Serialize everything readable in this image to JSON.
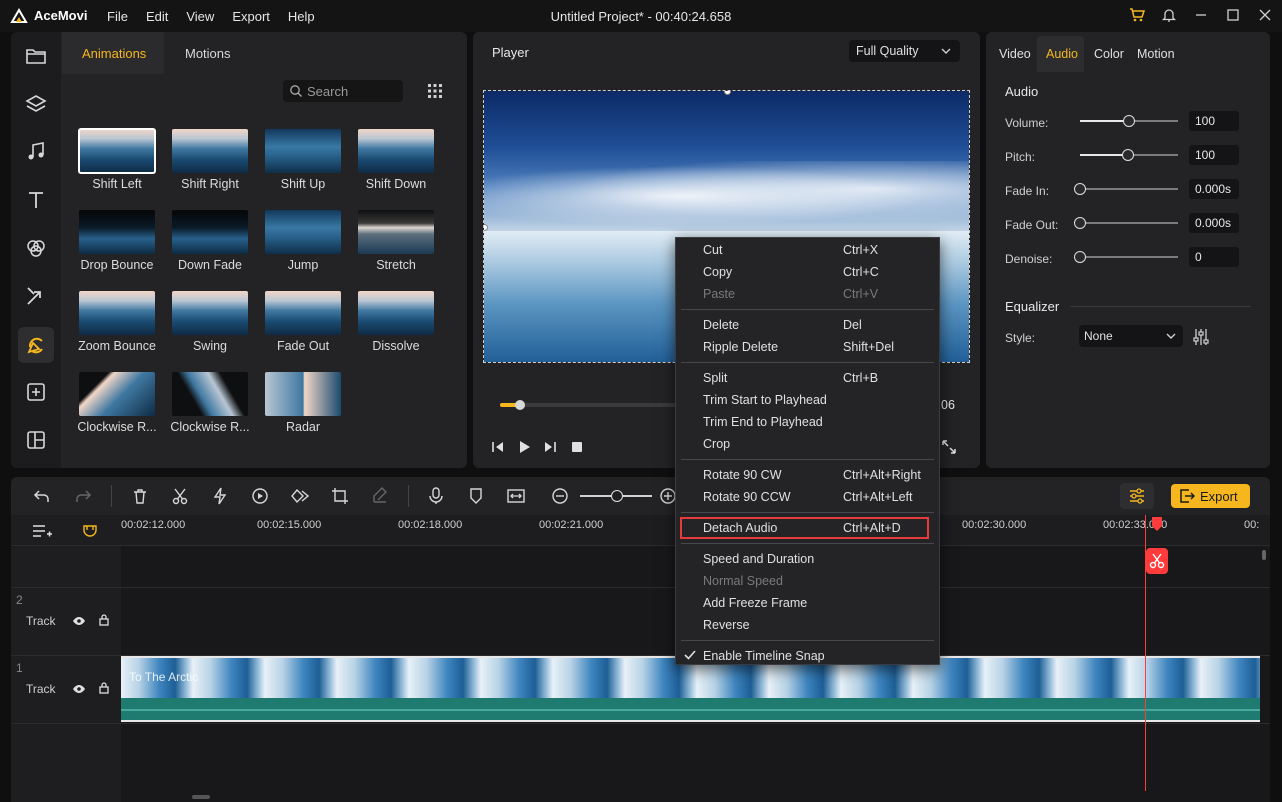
{
  "app": {
    "brand": "AceMovi",
    "window_title": "Untitled Project* - 00:40:24.658",
    "menu": [
      "File",
      "Edit",
      "View",
      "Export",
      "Help"
    ]
  },
  "media_panel": {
    "tabs": [
      "Animations",
      "Motions"
    ],
    "active_tab": "Animations",
    "search_placeholder": "Search",
    "animations": [
      "Shift Left",
      "Shift Right",
      "Shift Up",
      "Shift Down",
      "Drop Bounce",
      "Down Fade",
      "Jump",
      "Stretch",
      "Zoom Bounce",
      "Swing",
      "Fade Out",
      "Dissolve",
      "Clockwise R...",
      "Clockwise R...",
      "Radar"
    ],
    "selected_animation": "Shift Left",
    "sidebar_icons": [
      "folder-icon",
      "layers-icon",
      "music-icon",
      "text-icon",
      "filters-icon",
      "transitions-icon",
      "animation-icon",
      "sticker-icon",
      "split-screen-icon"
    ],
    "active_sidebar_icon": "animation-icon"
  },
  "player": {
    "title": "Player",
    "quality": "Full Quality",
    "timecode_tail": "06",
    "progress_fraction": 0.11
  },
  "properties": {
    "tabs": [
      "Video",
      "Audio",
      "Color",
      "Motion"
    ],
    "active_tab": "Audio",
    "audio_section": "Audio",
    "fields": [
      {
        "label": "Volume:",
        "value": "100",
        "fraction": 0.5
      },
      {
        "label": "Pitch:",
        "value": "100",
        "fraction": 0.49
      },
      {
        "label": "Fade In:",
        "value": "0.000s",
        "fraction": 0.0
      },
      {
        "label": "Fade Out:",
        "value": "0.000s",
        "fraction": 0.0
      },
      {
        "label": "Denoise:",
        "value": "0",
        "fraction": 0.0
      }
    ],
    "equalizer_section": "Equalizer",
    "style_label": "Style:",
    "style_value": "None"
  },
  "toolbar": {
    "export_label": "Export",
    "zoom_fraction": 0.5
  },
  "timeline": {
    "ticks": [
      "00:02:12.000",
      "00:02:15.000",
      "00:02:18.000",
      "00:02:21.000",
      "00:02:30.000",
      "00:02:33.000",
      "00:"
    ],
    "tracks": [
      {
        "number": "2",
        "label": "Track"
      },
      {
        "number": "1",
        "label": "Track"
      }
    ],
    "clip_title": "To The Arctic"
  },
  "context_menu": {
    "groups": [
      [
        {
          "label": "Cut",
          "shortcut": "Ctrl+X",
          "enabled": true
        },
        {
          "label": "Copy",
          "shortcut": "Ctrl+C",
          "enabled": true
        },
        {
          "label": "Paste",
          "shortcut": "Ctrl+V",
          "enabled": false
        }
      ],
      [
        {
          "label": "Delete",
          "shortcut": "Del",
          "enabled": true
        },
        {
          "label": "Ripple Delete",
          "shortcut": "Shift+Del",
          "enabled": true
        }
      ],
      [
        {
          "label": "Split",
          "shortcut": "Ctrl+B",
          "enabled": true
        },
        {
          "label": "Trim Start to Playhead",
          "shortcut": "",
          "enabled": true
        },
        {
          "label": "Trim End to Playhead",
          "shortcut": "",
          "enabled": true
        },
        {
          "label": "Crop",
          "shortcut": "",
          "enabled": true
        }
      ],
      [
        {
          "label": "Rotate 90 CW",
          "shortcut": "Ctrl+Alt+Right",
          "enabled": true
        },
        {
          "label": "Rotate 90 CCW",
          "shortcut": "Ctrl+Alt+Left",
          "enabled": true
        }
      ],
      [
        {
          "label": "Detach Audio",
          "shortcut": "Ctrl+Alt+D",
          "enabled": true,
          "highlighted": true
        }
      ],
      [
        {
          "label": "Speed and Duration",
          "shortcut": "",
          "enabled": true
        },
        {
          "label": "Normal Speed",
          "shortcut": "",
          "enabled": false
        },
        {
          "label": "Add Freeze Frame",
          "shortcut": "",
          "enabled": true
        },
        {
          "label": "Reverse",
          "shortcut": "",
          "enabled": true
        }
      ],
      [
        {
          "label": "Enable Timeline Snap",
          "shortcut": "",
          "enabled": true,
          "checked": true
        }
      ]
    ]
  },
  "colors": {
    "accent": "#f5b71d",
    "playhead": "#ff3b3b",
    "highlight_border": "#e63b3b"
  }
}
